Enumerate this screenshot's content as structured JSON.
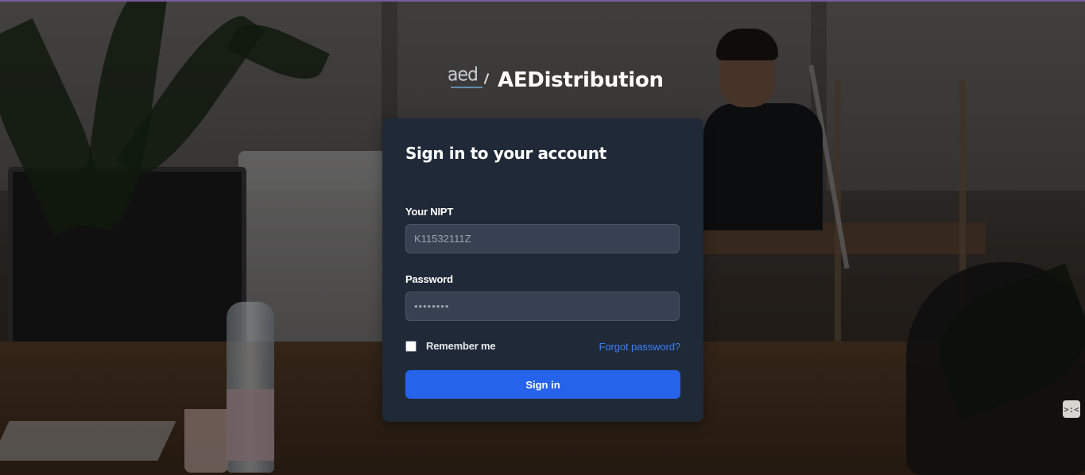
{
  "brand": {
    "logo_mark": "aed",
    "name": "AEDistribution"
  },
  "login": {
    "title": "Sign in to your account",
    "nipt_label": "Your NIPT",
    "nipt_value": "K11532111Z",
    "password_label": "Password",
    "password_value": "12345678",
    "remember_label": "Remember me",
    "remember_checked": false,
    "forgot_label": "Forgot password?",
    "submit_label": "Sign in"
  },
  "widget": {
    "icon": "face-icon",
    "glyph": ">:<"
  },
  "colors": {
    "card_bg": "#1f2937",
    "input_bg": "#374151",
    "primary": "#2563eb",
    "link": "#3b82f6"
  }
}
